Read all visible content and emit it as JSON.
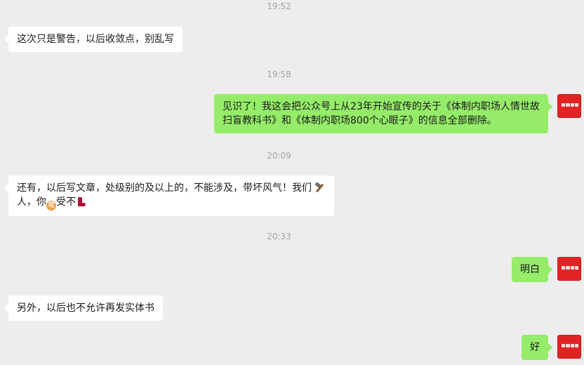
{
  "timestamps": [
    "19:52",
    "19:58",
    "20:09",
    "20:33"
  ],
  "messages": {
    "m1": "这次只是警告，以后收敛点，别乱写",
    "m2_line1": "见识了！我这会把公众号上从23年开始宣传的关于《体制内职场人情世故",
    "m2_line2": "扫盲教科书》和《体制内职场800个心眼子》的信息全部删除。",
    "m3_line1_text": "还有，以后写文章，处级别的及以上的，不能涉及，带坏风气！我们",
    "m3_line2_part1": "人，你",
    "m3_line2_part2": "受不",
    "m4": "明白",
    "m5": "另外，以后也不允许再发实体书",
    "m6": "好"
  },
  "emoji": {
    "hammer": "hammer-icon",
    "coin": "可",
    "boot": "boot-icon"
  },
  "colors": {
    "background": "#ededed",
    "incoming_bubble": "#ffffff",
    "outgoing_bubble": "#95ec69",
    "avatar": "#e02424",
    "timestamp_text": "#a3a3a3"
  }
}
